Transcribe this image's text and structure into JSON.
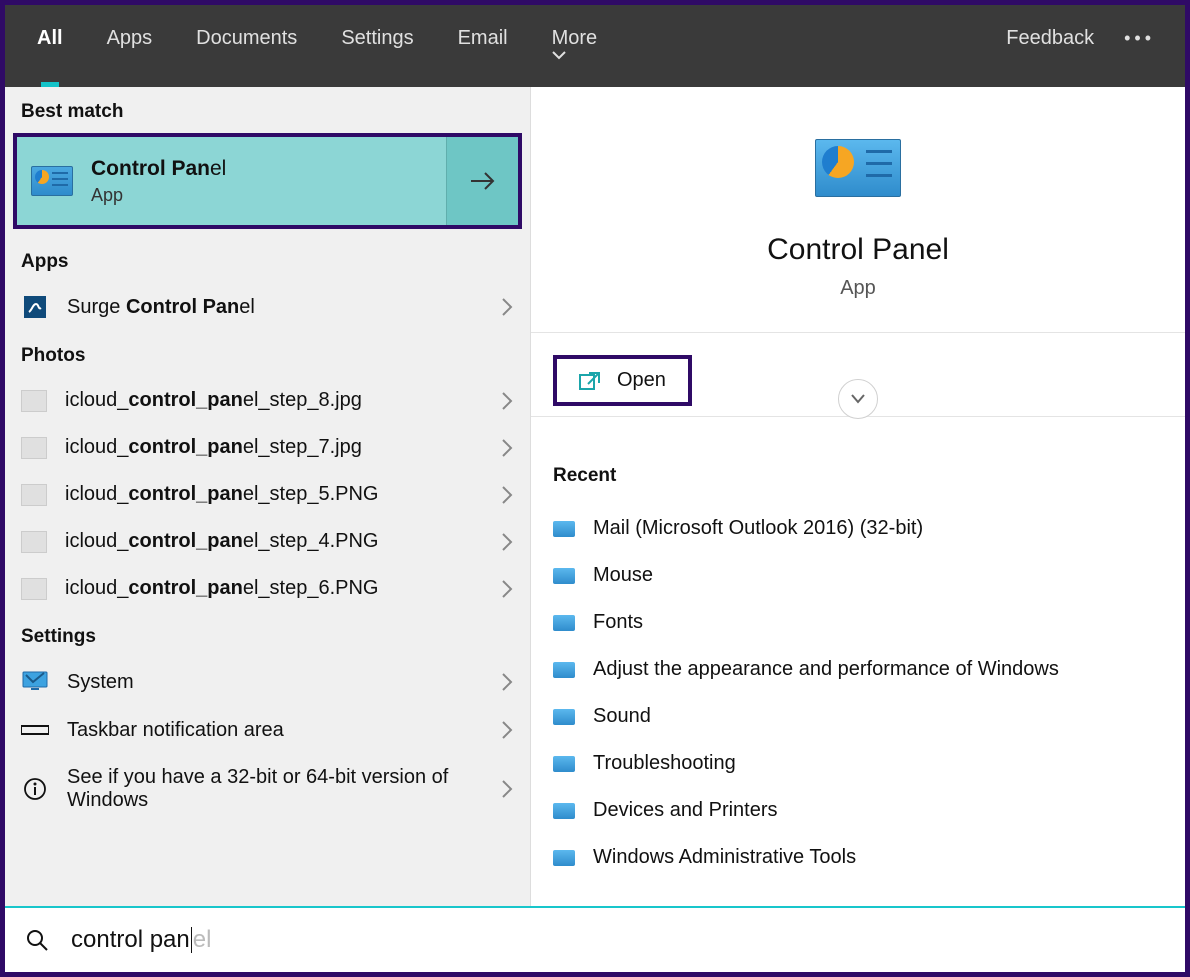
{
  "topbar": {
    "tabs": [
      "All",
      "Apps",
      "Documents",
      "Settings",
      "Email",
      "More"
    ],
    "active_index": 0,
    "feedback": "Feedback"
  },
  "left": {
    "best_match_label": "Best match",
    "best_match": {
      "name_prefix": "Control Pan",
      "name_suffix": "el",
      "type": "App"
    },
    "apps_label": "Apps",
    "apps": [
      {
        "prefix": "Surge ",
        "bold": "Control Pan",
        "suffix": "el"
      }
    ],
    "photos_label": "Photos",
    "photos": [
      {
        "prefix": "icloud_",
        "bold": "control_pan",
        "suffix": "el_step_8.jpg"
      },
      {
        "prefix": "icloud_",
        "bold": "control_pan",
        "suffix": "el_step_7.jpg"
      },
      {
        "prefix": "icloud_",
        "bold": "control_pan",
        "suffix": "el_step_5.PNG"
      },
      {
        "prefix": "icloud_",
        "bold": "control_pan",
        "suffix": "el_step_4.PNG"
      },
      {
        "prefix": "icloud_",
        "bold": "control_pan",
        "suffix": "el_step_6.PNG"
      }
    ],
    "settings_label": "Settings",
    "settings": [
      {
        "icon": "monitor",
        "label": "System"
      },
      {
        "icon": "taskbar",
        "label": "Taskbar notification area"
      },
      {
        "icon": "info",
        "label": "See if you have a 32-bit or 64-bit version of Windows"
      }
    ]
  },
  "right": {
    "title": "Control Panel",
    "subtitle": "App",
    "open_label": "Open",
    "recent_label": "Recent",
    "recent": [
      "Mail (Microsoft Outlook 2016) (32-bit)",
      "Mouse",
      "Fonts",
      "Adjust the appearance and performance of Windows",
      "Sound",
      "Troubleshooting",
      "Devices and Printers",
      "Windows Administrative Tools"
    ]
  },
  "search": {
    "typed": "control pan",
    "suggest": "el"
  }
}
